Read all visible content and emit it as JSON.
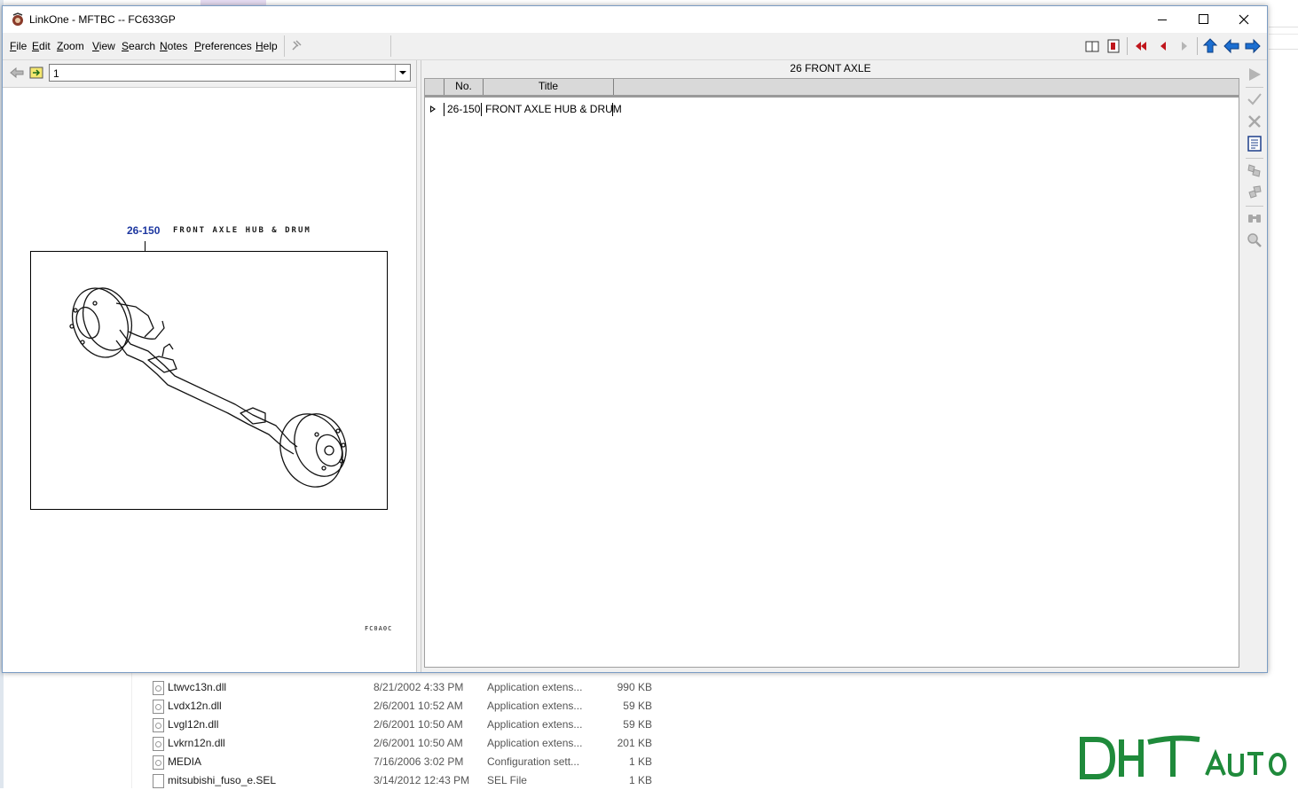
{
  "window": {
    "title": "LinkOne - MFTBC -- FC633GP"
  },
  "menu": [
    {
      "id": "file",
      "label": "File"
    },
    {
      "id": "edit",
      "label": "Edit"
    },
    {
      "id": "zoom",
      "label": "Zoom"
    },
    {
      "id": "view",
      "label": "View"
    },
    {
      "id": "search",
      "label": "Search"
    },
    {
      "id": "notes",
      "label": "Notes"
    },
    {
      "id": "preferences",
      "label": "Preferences"
    },
    {
      "id": "help",
      "label": "Help"
    }
  ],
  "left": {
    "page_value": "1",
    "illustration": {
      "number": "26-150",
      "label": "FRONT AXLE HUB & DRUM",
      "code": "FC0A0C"
    }
  },
  "right": {
    "list_title": "26 FRONT AXLE",
    "columns": [
      "No.",
      "Title"
    ],
    "rows": [
      {
        "no": "26-150",
        "title": "FRONT AXLE HUB & DRUM"
      }
    ]
  },
  "background_files": [
    {
      "name": "Ltwvc13n.dll",
      "date": "8/21/2002 4:33 PM",
      "type": "Application extens...",
      "size": "990 KB",
      "icon": "dll-icon"
    },
    {
      "name": "Lvdx12n.dll",
      "date": "2/6/2001 10:52 AM",
      "type": "Application extens...",
      "size": "59 KB",
      "icon": "dll-icon"
    },
    {
      "name": "Lvgl12n.dll",
      "date": "2/6/2001 10:50 AM",
      "type": "Application extens...",
      "size": "59 KB",
      "icon": "dll-icon"
    },
    {
      "name": "Lvkrn12n.dll",
      "date": "2/6/2001 10:50 AM",
      "type": "Application extens...",
      "size": "201 KB",
      "icon": "dll-icon"
    },
    {
      "name": "MEDIA",
      "date": "7/16/2006 3:02 PM",
      "type": "Configuration sett...",
      "size": "1 KB",
      "icon": "config-file-icon"
    },
    {
      "name": "mitsubishi_fuso_e.SEL",
      "date": "3/14/2012 12:43 PM",
      "type": "SEL File",
      "size": "1 KB",
      "icon": "file-icon"
    }
  ],
  "logo": {
    "text": "DHT AUTO",
    "color": "#1f8a3b"
  },
  "colors": {
    "illustration_number": "#1d37a0",
    "nav_arrow_red": "#c0161c",
    "nav_arrow_blue": "#1c6fd1"
  }
}
